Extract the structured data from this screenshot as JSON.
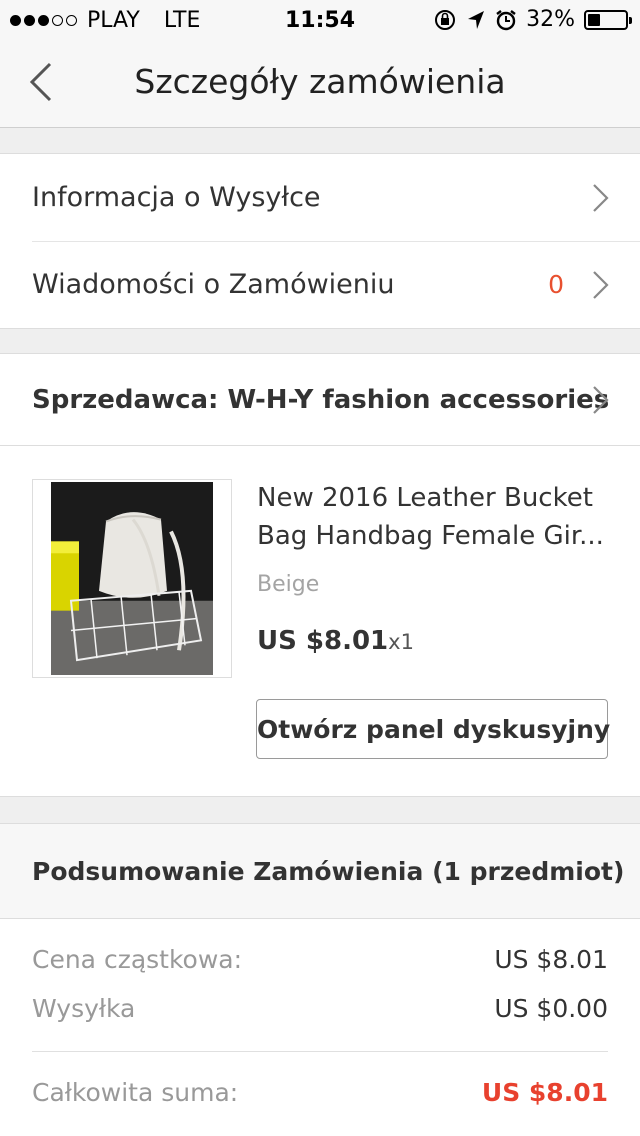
{
  "status_bar": {
    "carrier": "PLAY",
    "network": "LTE",
    "time": "11:54",
    "battery": "32%",
    "signal_strength": 3,
    "battery_level": 0.32
  },
  "nav": {
    "title": "Szczegóły zamówienia"
  },
  "info_rows": {
    "shipping_label": "Informacja o Wysyłce",
    "messages_label": "Wiadomości o Zamówieniu",
    "messages_count": "0"
  },
  "seller": {
    "label": "Sprzedawca: W-H-Y fashion accessories"
  },
  "product": {
    "title": "New 2016 Leather Bucket Bag Handbag Female Gir...",
    "variant": "Beige",
    "price": "US $8.01",
    "quantity": "x1",
    "discuss_button": "Otwórz panel dyskusyjny"
  },
  "summary": {
    "heading": "Podsumowanie Zamówienia (1 przedmiot)",
    "subtotal_label": "Cena cząstkowa:",
    "subtotal_value": "US $8.01",
    "shipping_label": "Wysyłka",
    "shipping_value": "US $0.00",
    "total_label": "Całkowita suma:",
    "total_value": "US $8.01"
  },
  "colors": {
    "accent_red": "#e8412e",
    "count_orange": "#e8502f",
    "background": "#efefef"
  }
}
